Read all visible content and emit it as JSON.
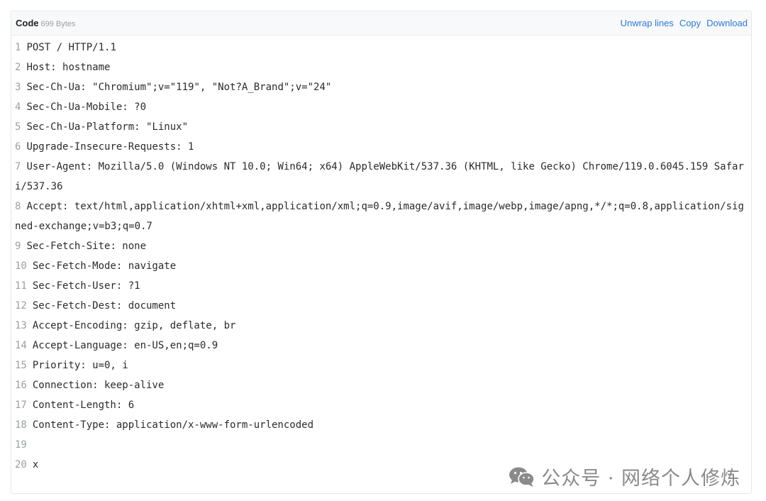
{
  "header": {
    "title": "Code",
    "size": "699 Bytes",
    "actions": {
      "unwrap": "Unwrap lines",
      "copy": "Copy",
      "download": "Download"
    }
  },
  "lines": [
    {
      "num": "1",
      "text": "POST / HTTP/1.1"
    },
    {
      "num": "2",
      "text": "Host: hostname"
    },
    {
      "num": "3",
      "text": "Sec-Ch-Ua: \"Chromium\";v=\"119\", \"Not?A_Brand\";v=\"24\""
    },
    {
      "num": "4",
      "text": "Sec-Ch-Ua-Mobile: ?0"
    },
    {
      "num": "5",
      "text": "Sec-Ch-Ua-Platform: \"Linux\""
    },
    {
      "num": "6",
      "text": "Upgrade-Insecure-Requests: 1"
    },
    {
      "num": "7",
      "text": "User-Agent: Mozilla/5.0 (Windows NT 10.0; Win64; x64) AppleWebKit/537.36 (KHTML, like Gecko) Chrome/119.0.6045.159 Safari/537.36"
    },
    {
      "num": "8",
      "text": "Accept: text/html,application/xhtml+xml,application/xml;q=0.9,image/avif,image/webp,image/apng,*/*;q=0.8,application/signed-exchange;v=b3;q=0.7"
    },
    {
      "num": "9",
      "text": "Sec-Fetch-Site: none"
    },
    {
      "num": "10",
      "text": "Sec-Fetch-Mode: navigate"
    },
    {
      "num": "11",
      "text": "Sec-Fetch-User: ?1"
    },
    {
      "num": "12",
      "text": "Sec-Fetch-Dest: document"
    },
    {
      "num": "13",
      "text": "Accept-Encoding: gzip, deflate, br"
    },
    {
      "num": "14",
      "text": "Accept-Language: en-US,en;q=0.9"
    },
    {
      "num": "15",
      "text": "Priority: u=0, i"
    },
    {
      "num": "16",
      "text": "Connection: keep-alive"
    },
    {
      "num": "17",
      "text": "Content-Length: 6"
    },
    {
      "num": "18",
      "text": "Content-Type: application/x-www-form-urlencoded"
    },
    {
      "num": "19",
      "text": ""
    },
    {
      "num": "20",
      "text": "x"
    }
  ],
  "watermark": {
    "text": "公众号 · 网络个人修炼",
    "icon": "wechat-icon"
  }
}
